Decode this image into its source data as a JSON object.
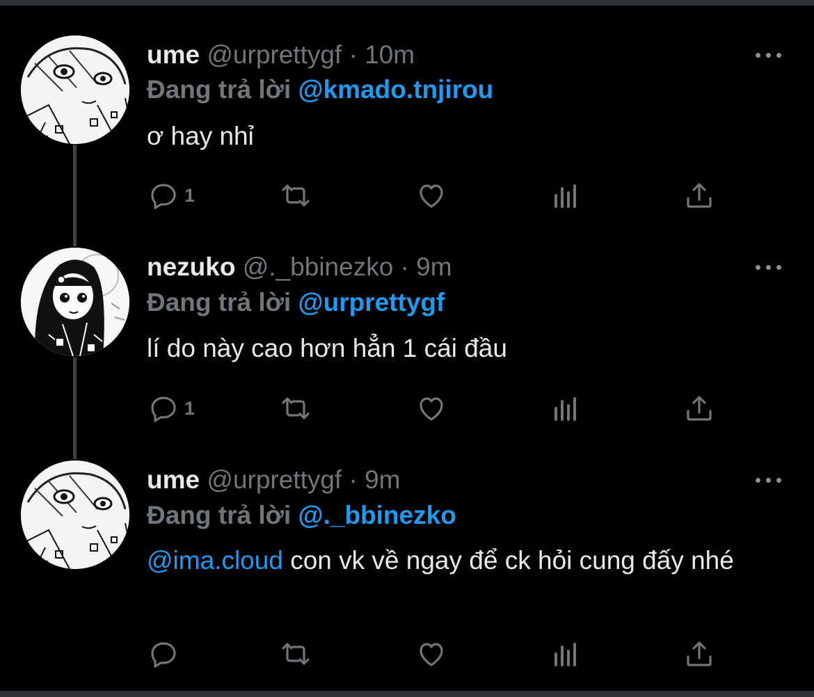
{
  "colors": {
    "background": "#000000",
    "text": "#e7e9ea",
    "muted": "#71767b",
    "accent": "#1d9bf0",
    "thread_line": "#3e4144"
  },
  "tweets": [
    {
      "name": "ume",
      "handle": "@urprettygf",
      "separator": "·",
      "time": "10m",
      "reply_prefix": "Đang trả lời",
      "reply_to": "@kmado.tnjirou",
      "body_mention": "",
      "body_text": "ơ hay nhỉ",
      "reply_count": "1",
      "avatar": "ume-avatar"
    },
    {
      "name": "nezuko",
      "handle": "@._bbinezko",
      "separator": "·",
      "time": "9m",
      "reply_prefix": "Đang trả lời",
      "reply_to": "@urprettygf",
      "body_mention": "",
      "body_text": "lí do này cao hơn hẳn 1 cái đầu",
      "reply_count": "1",
      "avatar": "nezuko-avatar"
    },
    {
      "name": "ume",
      "handle": "@urprettygf",
      "separator": "·",
      "time": "9m",
      "reply_prefix": "Đang trả lời",
      "reply_to": "@._bbinezko",
      "body_mention": "@ima.cloud",
      "body_text": " con vk về ngay để ck hỏi cung đấy nhé",
      "reply_count": "",
      "avatar": "ume-avatar"
    }
  ],
  "icons": [
    "reply-icon",
    "retweet-icon",
    "like-icon",
    "analytics-icon",
    "share-icon",
    "more-icon"
  ]
}
